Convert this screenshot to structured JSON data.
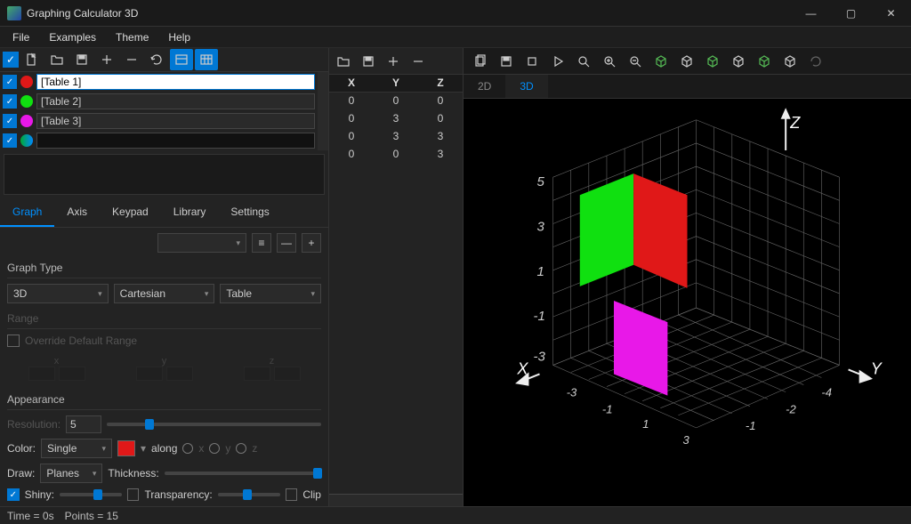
{
  "app": {
    "title": "Graphing Calculator 3D"
  },
  "window_controls": {
    "min": "—",
    "max": "▢",
    "close": "✕"
  },
  "menu": [
    "File",
    "Examples",
    "Theme",
    "Help"
  ],
  "tables": [
    {
      "name": "[Table 1]",
      "color": "#e01818",
      "checked": true,
      "editing": true
    },
    {
      "name": "[Table 2]",
      "color": "#10e010",
      "checked": true,
      "editing": false
    },
    {
      "name": "[Table 3]",
      "color": "#e818e8",
      "checked": true,
      "editing": false
    }
  ],
  "tabs": [
    "Graph",
    "Axis",
    "Keypad",
    "Library",
    "Settings"
  ],
  "active_tab": "Graph",
  "graph_type": {
    "heading": "Graph Type",
    "dim": "3D",
    "system": "Cartesian",
    "mode": "Table"
  },
  "range": {
    "heading": "Range",
    "override_label": "Override Default Range",
    "axes": [
      "x",
      "y",
      "z"
    ]
  },
  "appearance": {
    "heading": "Appearance",
    "resolution_label": "Resolution:",
    "resolution_value": "5",
    "color_label": "Color:",
    "color_mode": "Single",
    "color_swatch": "#e01818",
    "along_label": "along",
    "along_axes": [
      "x",
      "y",
      "z"
    ],
    "draw_label": "Draw:",
    "draw_mode": "Planes",
    "thickness_label": "Thickness:",
    "shiny_label": "Shiny:",
    "shiny_checked": true,
    "transparency_label": "Transparency:",
    "clip_label": "Clip"
  },
  "data_table": {
    "headers": [
      "X",
      "Y",
      "Z"
    ],
    "rows": [
      [
        0,
        0,
        0
      ],
      [
        0,
        3,
        0
      ],
      [
        0,
        3,
        3
      ],
      [
        0,
        0,
        3
      ]
    ]
  },
  "view_tabs": [
    "2D",
    "3D"
  ],
  "active_view": "3D",
  "axes3d": {
    "x": "X",
    "y": "Y",
    "z": "Z"
  },
  "z_ticks": [
    "5",
    "3",
    "1",
    "-1",
    "-3"
  ],
  "xy_ticks": [
    "-3",
    "-1",
    "1",
    "3",
    "-4",
    "-2",
    "-1"
  ],
  "status": {
    "time": "Time = 0s",
    "points": "Points = 15"
  },
  "chart_data": {
    "type": "table",
    "note": "3D surface viewport showing three colored rectangular planes on a cubic grid with labeled Z axis ticks 5,3,1,-1,-3",
    "planes": [
      {
        "color": "#10e010",
        "approx": "green plane near x=0, y∈[-1,1], z∈[1,4]"
      },
      {
        "color": "#e01818",
        "approx": "red plane near x=0, y∈[1,3], z∈[0.5,3.5]"
      },
      {
        "color": "#e818e8",
        "approx": "magenta plane near x=0, y∈[0,2], z∈[-3,0]"
      }
    ]
  }
}
